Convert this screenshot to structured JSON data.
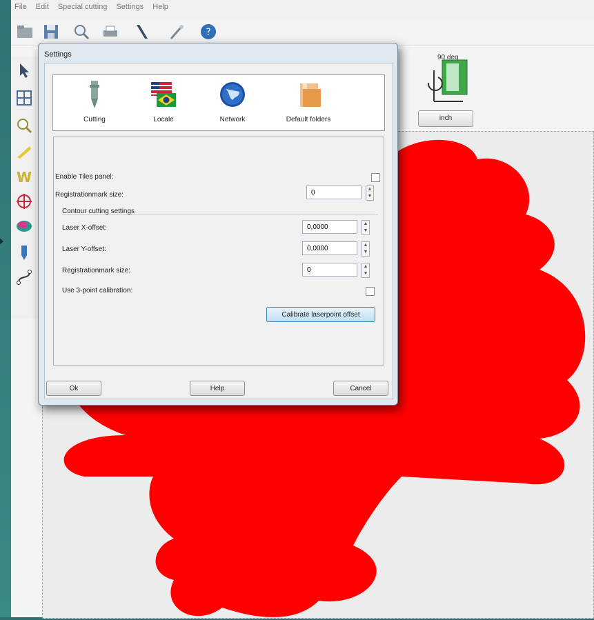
{
  "menu": [
    "File",
    "Edit",
    "Special cutting",
    "Settings",
    "Help"
  ],
  "props": {
    "degree_label": "90 deg",
    "unit_button": "inch"
  },
  "dialog": {
    "title": "Settings",
    "tabs": [
      {
        "label": "Cutting"
      },
      {
        "label": "Locale"
      },
      {
        "label": "Network"
      },
      {
        "label": "Default folders"
      }
    ],
    "enable_tiles_label": "Enable Tiles panel:",
    "reg_mark_size_label": "Registrationmark size:",
    "reg_mark_size_value": "0",
    "contour_group_label": "Contour cutting settings",
    "laser_x_label": "Laser X-offset:",
    "laser_x_value": "0,0000",
    "laser_y_label": "Laser Y-offset:",
    "laser_y_value": "0,0000",
    "contour_reg_mark_label": "Registrationmark size:",
    "contour_reg_mark_value": "0",
    "three_point_label": "Use 3-point calibration:",
    "calibrate_button": "Calibrate laserpoint offset",
    "ok_button": "Ok",
    "help_button": "Help",
    "cancel_button": "Cancel"
  },
  "colors": {
    "shape_fill": "#ff0000",
    "accent": "#3c7fb1"
  }
}
